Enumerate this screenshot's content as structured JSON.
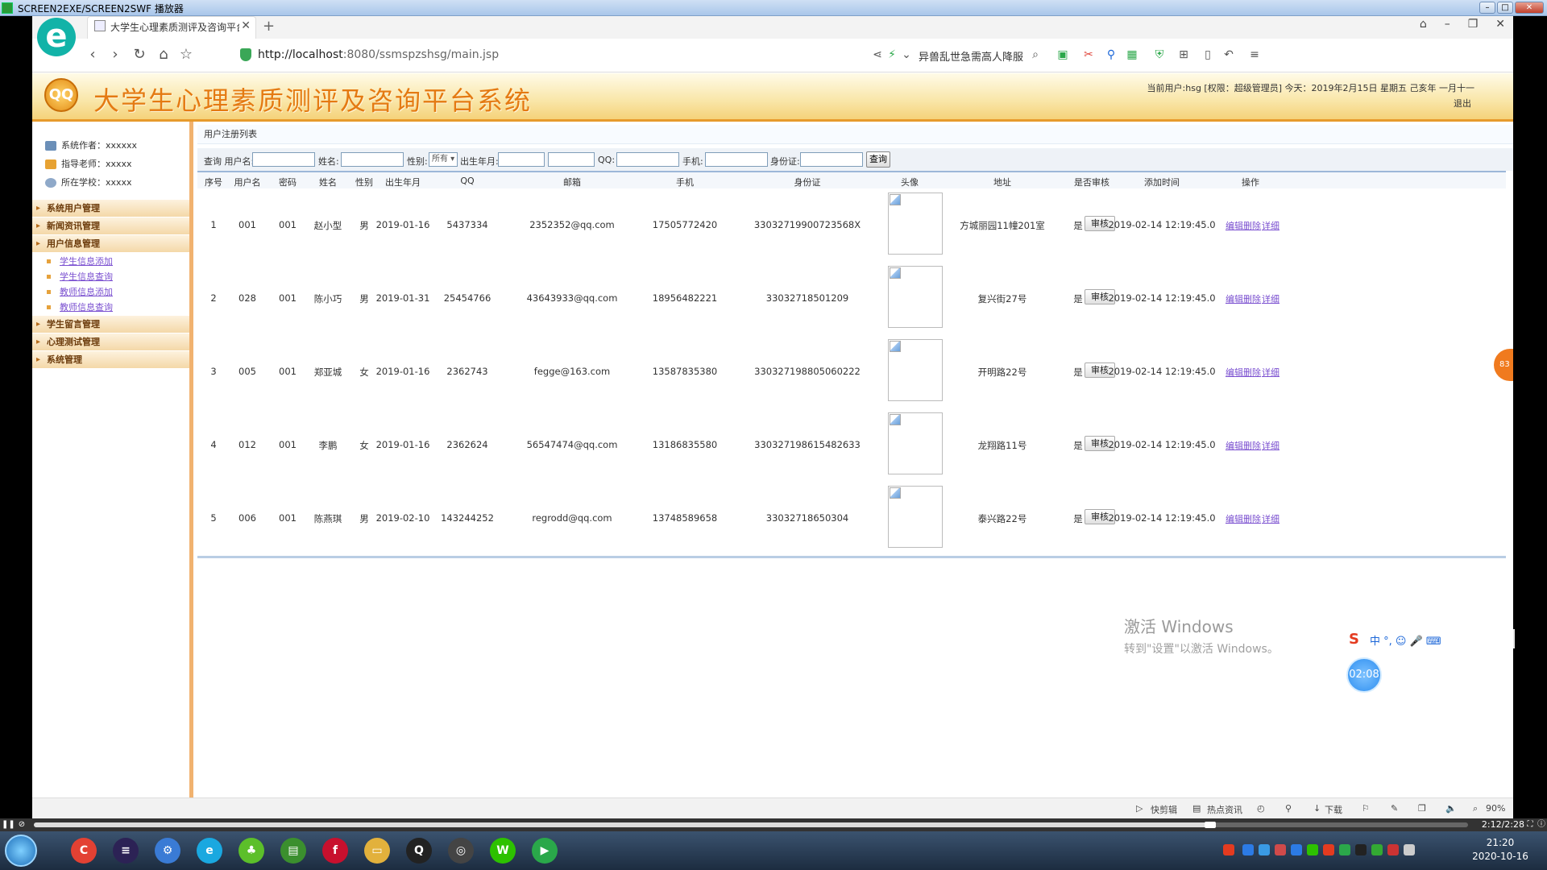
{
  "player": {
    "title": "SCREEN2EXE/SCREEN2SWF 播放器",
    "time": "2:12/2:28",
    "progress": 0.82
  },
  "browser": {
    "tab_title": "大学生心理素质测评及咨询平台",
    "url_host": "http://localhost",
    "url_rest": ":8080/ssmspzshsg/main.jsp",
    "search_hint": "异兽乱世急需高人降服",
    "nav_icons": [
      "back-icon",
      "forward-icon",
      "reload-icon",
      "home-icon",
      "star-icon"
    ],
    "zoom": "90%"
  },
  "header": {
    "title": "大学生心理素质测评及咨询平台系统",
    "logo_text": "QQ",
    "user_info": "当前用户:hsg [权限：超级管理员] 今天：2019年2月15日 星期五 己亥年 一月十一",
    "logout": "退出"
  },
  "sidebar": {
    "info": [
      {
        "label": "系统作者：xxxxxx",
        "color": "#6b8fb8"
      },
      {
        "label": "指导老师：xxxxx",
        "color": "#e7a233"
      },
      {
        "label": "所在学校：xxxxx",
        "color": "#8fa9c9"
      }
    ],
    "menu": [
      {
        "label": "系统用户管理"
      },
      {
        "label": "新闻资讯管理"
      },
      {
        "label": "用户信息管理",
        "children": [
          "学生信息添加",
          "学生信息查询",
          "教师信息添加",
          "教师信息查询"
        ]
      },
      {
        "label": "学生留言管理"
      },
      {
        "label": "心理测试管理"
      },
      {
        "label": "系统管理"
      }
    ]
  },
  "content": {
    "heading": "用户注册列表",
    "filter": {
      "query_label": "查询 用户名:",
      "name_label": "姓名:",
      "gender_label": "性别:",
      "gender_value": "所有",
      "birth_label": "出生年月:",
      "qq_label": "QQ:",
      "phone_label": "手机:",
      "id_label": "身份证:",
      "search_button": "查询"
    },
    "columns": [
      "序号",
      "用户名",
      "密码",
      "姓名",
      "性别",
      "出生年月",
      "QQ",
      "邮箱",
      "手机",
      "身份证",
      "头像",
      "地址",
      "是否审核",
      "添加时间",
      "操作"
    ],
    "audit_button": "审核",
    "ops": [
      "编辑",
      "删除",
      "详细"
    ],
    "rows": [
      {
        "no": "1",
        "username": "001",
        "password": "001",
        "name": "赵小型",
        "gender": "男",
        "birth": "2019-01-16",
        "qq": "5437334",
        "email": "2352352@qq.com",
        "phone": "17505772420",
        "idcard": "33032719900723568X",
        "address": "方城丽园11幢201室",
        "audited": "是",
        "added": "2019-02-14 12:19:45.0"
      },
      {
        "no": "2",
        "username": "028",
        "password": "001",
        "name": "陈小巧",
        "gender": "男",
        "birth": "2019-01-31",
        "qq": "25454766",
        "email": "43643933@qq.com",
        "phone": "18956482221",
        "idcard": "33032718501209",
        "address": "复兴街27号",
        "audited": "是",
        "added": "2019-02-14 12:19:45.0"
      },
      {
        "no": "3",
        "username": "005",
        "password": "001",
        "name": "郑亚城",
        "gender": "女",
        "birth": "2019-01-16",
        "qq": "2362743",
        "email": "fegge@163.com",
        "phone": "13587835380",
        "idcard": "330327198805060222",
        "address": "开明路22号",
        "audited": "是",
        "added": "2019-02-14 12:19:45.0"
      },
      {
        "no": "4",
        "username": "012",
        "password": "001",
        "name": "李鹏",
        "gender": "女",
        "birth": "2019-01-16",
        "qq": "2362624",
        "email": "56547474@qq.com",
        "phone": "13186835580",
        "idcard": "330327198615482633",
        "address": "龙翔路11号",
        "audited": "是",
        "added": "2019-02-14 12:19:45.0"
      },
      {
        "no": "5",
        "username": "006",
        "password": "001",
        "name": "陈燕琪",
        "gender": "男",
        "birth": "2019-02-10",
        "qq": "143244252",
        "email": "regrodd@qq.com",
        "phone": "13748589658",
        "idcard": "33032718650304",
        "address": "泰兴路22号",
        "audited": "是",
        "added": "2019-02-14 12:19:45.0"
      }
    ]
  },
  "overlay": {
    "watermark_line1": "激活 Windows",
    "watermark_line2": "转到\"设置\"以激活 Windows。",
    "timer": "02:08",
    "orange_badge": "83",
    "ime_text": "中 °, ☺ 🎤 ⌨"
  },
  "statusbar": {
    "items": [
      "快剪辑",
      "热点资讯",
      "下载"
    ]
  },
  "taskbar": {
    "apps": [
      {
        "name": "chrome",
        "color": "#e34133",
        "glyph": "C"
      },
      {
        "name": "eclipse",
        "color": "#2c2255",
        "glyph": "≡"
      },
      {
        "name": "app3",
        "color": "#3a7bd5",
        "glyph": "⚙"
      },
      {
        "name": "browser-e",
        "color": "#1aa8e0",
        "glyph": "e"
      },
      {
        "name": "app5",
        "color": "#5cbf2a",
        "glyph": "♣"
      },
      {
        "name": "app6",
        "color": "#3b8f2e",
        "glyph": "▤"
      },
      {
        "name": "flash",
        "color": "#c8102e",
        "glyph": "f"
      },
      {
        "name": "explorer",
        "color": "#e2b13c",
        "glyph": "▭"
      },
      {
        "name": "qq",
        "color": "#222",
        "glyph": "Q"
      },
      {
        "name": "app10",
        "color": "#444",
        "glyph": "◎"
      },
      {
        "name": "wechat",
        "color": "#2dc100",
        "glyph": "W"
      },
      {
        "name": "player",
        "color": "#2aa84a",
        "glyph": "▶"
      }
    ],
    "clock_time": "21:20",
    "clock_date": "2020-10-16"
  },
  "colors": {
    "accent": "#e47a12",
    "link": "#7a4fd0",
    "header_border": "#e79a2c"
  }
}
